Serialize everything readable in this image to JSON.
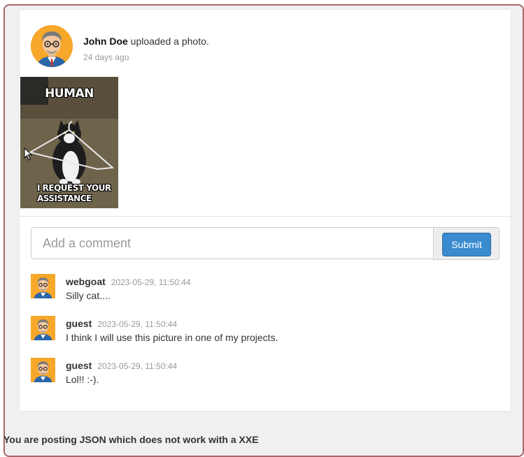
{
  "post": {
    "author": "John Doe",
    "action": " uploaded a photo.",
    "time": "24 days ago",
    "photo": {
      "top_caption": "HUMAN",
      "bottom_caption": "I REQUEST YOUR ASSISTANCE"
    }
  },
  "comment_form": {
    "placeholder": "Add a comment",
    "submit_label": "Submit"
  },
  "comments": [
    {
      "user": "webgoat",
      "time": "2023-05-29, 11:50:44",
      "text": "Silly cat...."
    },
    {
      "user": "guest",
      "time": "2023-05-29, 11:50:44",
      "text": "I think I will use this picture in one of my projects."
    },
    {
      "user": "guest",
      "time": "2023-05-29, 11:50:44",
      "text": "Lol!! :-)."
    }
  ],
  "footer": {
    "message": "You are posting JSON which does not work with a XXE"
  },
  "colors": {
    "frame_border": "#a8686a",
    "submit_bg": "#3a8bd0",
    "avatar_bg": "#f7a72a"
  }
}
